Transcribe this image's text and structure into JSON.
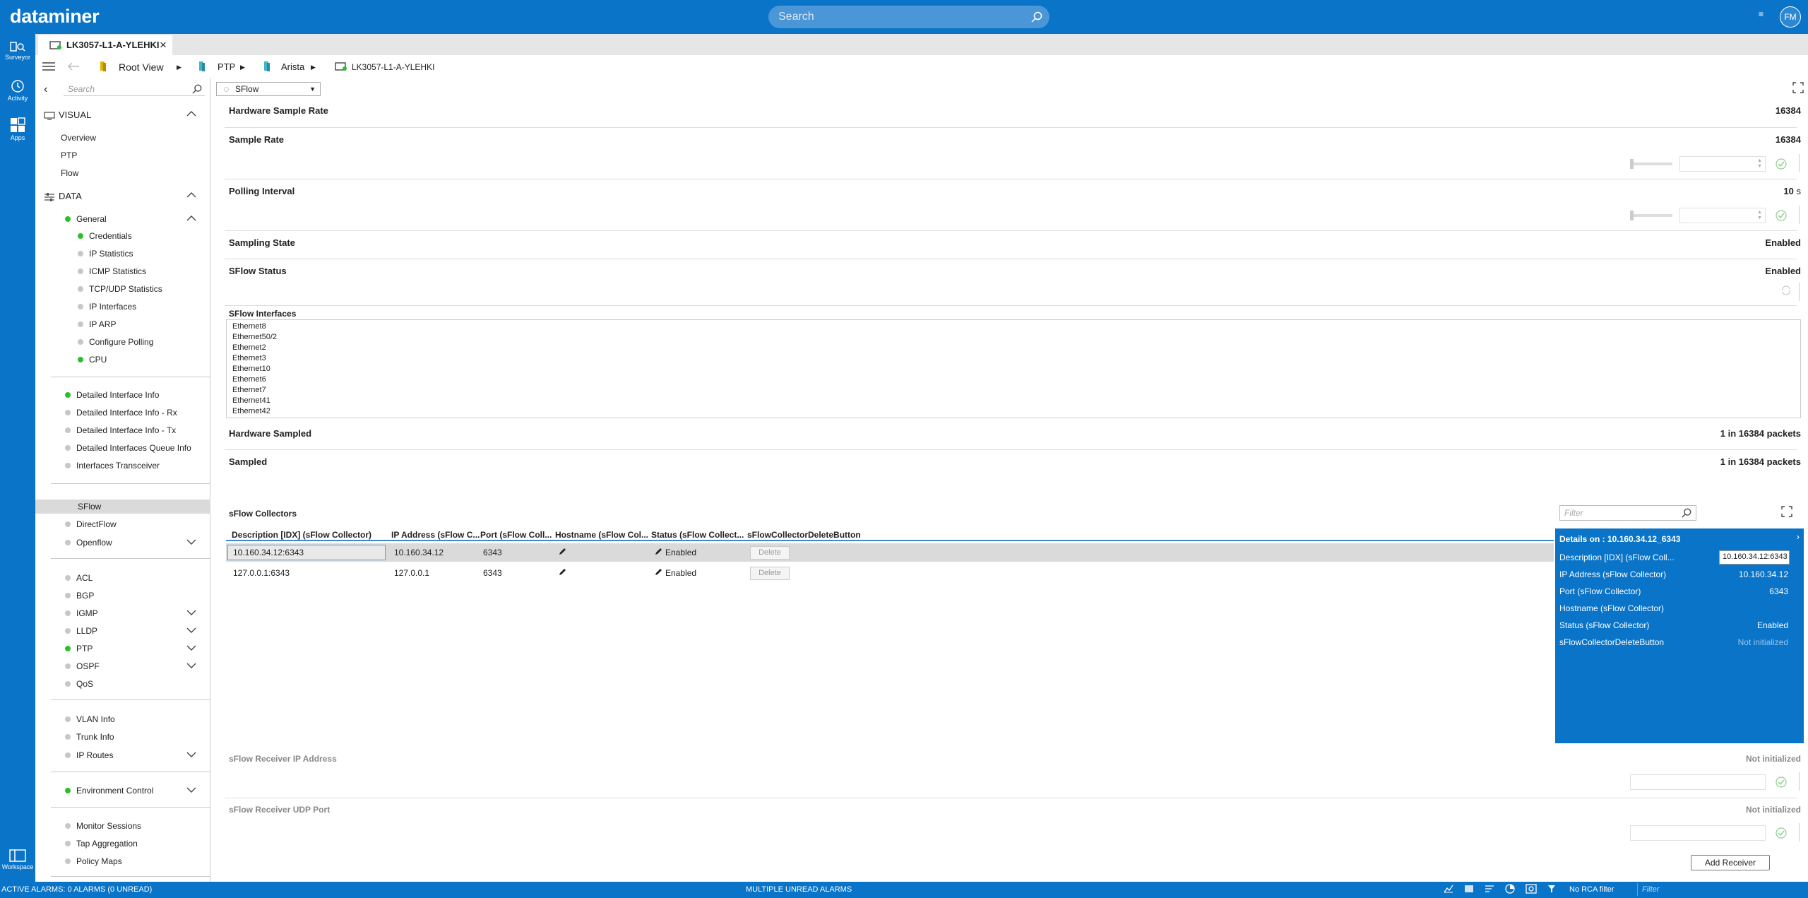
{
  "app": {
    "title": "dataminer",
    "search_placeholder": "Search",
    "avatar": "FM",
    "menu_glyph": "≡"
  },
  "leftnav": [
    {
      "label": "Surveyor",
      "icon": "surveyor-icon"
    },
    {
      "label": "Activity",
      "icon": "clock-icon"
    },
    {
      "label": "Apps",
      "icon": "apps-icon"
    },
    {
      "label": "Workspace",
      "icon": "workspace-icon"
    }
  ],
  "tab": {
    "title": "LK3057-L1-A-YLEHKI",
    "close": "×"
  },
  "breadcrumb": [
    "Root View",
    "PTP",
    "Arista",
    "LK3057-L1-A-YLEHKI"
  ],
  "sidebar": {
    "search_placeholder": "Search",
    "visual_header": "VISUAL",
    "visual_items": [
      "Overview",
      "PTP",
      "Flow"
    ],
    "data_header": "DATA",
    "general": {
      "label": "General",
      "status": "green"
    },
    "general_items": [
      {
        "label": "Credentials",
        "status": "green"
      },
      {
        "label": "IP Statistics",
        "status": "gray"
      },
      {
        "label": "ICMP Statistics",
        "status": "gray"
      },
      {
        "label": "TCP/UDP Statistics",
        "status": "gray"
      },
      {
        "label": "IP Interfaces",
        "status": "gray"
      },
      {
        "label": "IP ARP",
        "status": "gray"
      },
      {
        "label": "Configure Polling",
        "status": "gray"
      },
      {
        "label": "CPU",
        "status": "green"
      }
    ],
    "group2": [
      {
        "label": "Detailed Interface Info",
        "status": "green"
      },
      {
        "label": "Detailed Interface Info - Rx",
        "status": "gray"
      },
      {
        "label": "Detailed Interface Info - Tx",
        "status": "gray"
      },
      {
        "label": "Detailed Interfaces Queue Info",
        "status": "gray"
      },
      {
        "label": "Interfaces Transceiver",
        "status": "gray"
      }
    ],
    "group3": [
      {
        "label": "SFlow",
        "status": "none"
      },
      {
        "label": "DirectFlow",
        "status": "gray"
      },
      {
        "label": "Openflow",
        "status": "gray"
      }
    ],
    "group4": [
      {
        "label": "ACL",
        "status": "gray"
      },
      {
        "label": "BGP",
        "status": "gray"
      },
      {
        "label": "IGMP",
        "status": "gray"
      },
      {
        "label": "LLDP",
        "status": "gray"
      },
      {
        "label": "PTP",
        "status": "green"
      },
      {
        "label": "OSPF",
        "status": "gray"
      },
      {
        "label": "QoS",
        "status": "gray"
      }
    ],
    "group5": [
      {
        "label": "VLAN Info",
        "status": "gray"
      },
      {
        "label": "Trunk Info",
        "status": "gray"
      },
      {
        "label": "IP Routes",
        "status": "gray"
      }
    ],
    "group6": [
      {
        "label": "Environment Control",
        "status": "green"
      }
    ],
    "group7": [
      {
        "label": "Monitor Sessions",
        "status": "gray"
      },
      {
        "label": "Tap Aggregation",
        "status": "gray"
      },
      {
        "label": "Policy Maps",
        "status": "gray"
      }
    ]
  },
  "page": {
    "dropdown": "SFlow",
    "params": {
      "hw_sample_rate": {
        "label": "Hardware Sample Rate",
        "value": "16384"
      },
      "sample_rate": {
        "label": "Sample Rate",
        "value": "16384"
      },
      "polling_interval": {
        "label": "Polling Interval",
        "value": "10",
        "unit": "s"
      },
      "sampling_state": {
        "label": "Sampling State",
        "value": "Enabled"
      },
      "sflow_status": {
        "label": "SFlow Status",
        "value": "Enabled"
      },
      "interfaces_label": "SFlow Interfaces",
      "hw_sampled": {
        "label": "Hardware Sampled",
        "value": "1 in 16384 packets"
      },
      "sampled": {
        "label": "Sampled",
        "value": "1 in 16384 packets"
      },
      "receiver_ip": {
        "label": "sFlow Receiver IP Address",
        "value": "Not initialized"
      },
      "receiver_port": {
        "label": "sFlow Receiver UDP Port",
        "value": "Not initialized"
      }
    },
    "interfaces": [
      "Ethernet8",
      "Ethernet50/2",
      "Ethernet2",
      "Ethernet3",
      "Ethernet10",
      "Ethernet6",
      "Ethernet7",
      "Ethernet41",
      "Ethernet42"
    ],
    "collectors": {
      "title": "sFlow Collectors",
      "filter_placeholder": "Filter",
      "columns": [
        "Description [IDX] (sFlow Collector)",
        "IP Address (sFlow C...",
        "Port (sFlow Coll...",
        "Hostname (sFlow Col...",
        "Status (sFlow Collect...",
        "sFlowCollectorDeleteButton"
      ],
      "rows": [
        {
          "desc": "10.160.34.12:6343",
          "ip": "10.160.34.12",
          "port": "6343",
          "status": "Enabled",
          "delete": "Delete"
        },
        {
          "desc": "127.0.0.1:6343",
          "ip": "127.0.0.1",
          "port": "6343",
          "status": "Enabled",
          "delete": "Delete"
        }
      ]
    },
    "details": {
      "title": "Details on : 10.160.34.12_6343",
      "close": "›",
      "rows": [
        {
          "label": "Description [IDX] (sFlow Coll...",
          "value": "10.160.34.12:6343"
        },
        {
          "label": "IP Address (sFlow Collector)",
          "value": "10.160.34.12"
        },
        {
          "label": "Port (sFlow Collector)",
          "value": "6343"
        },
        {
          "label": "Hostname (sFlow Collector)",
          "value": ""
        },
        {
          "label": "Status (sFlow Collector)",
          "value": "Enabled"
        },
        {
          "label": "sFlowCollectorDeleteButton",
          "value": "Not initialized"
        }
      ]
    },
    "add_receiver": "Add Receiver"
  },
  "statusbar": {
    "left": "ACTIVE ALARMS: 0 ALARMS (0 UNREAD)",
    "center": "MULTIPLE UNREAD ALARMS",
    "no_rca": "No RCA filter",
    "filter_placeholder": "Filter"
  },
  "colors": {
    "brand": "#0a74c8",
    "ok_green": "#2bc02b",
    "inactive_gray": "#c7c7c7"
  }
}
